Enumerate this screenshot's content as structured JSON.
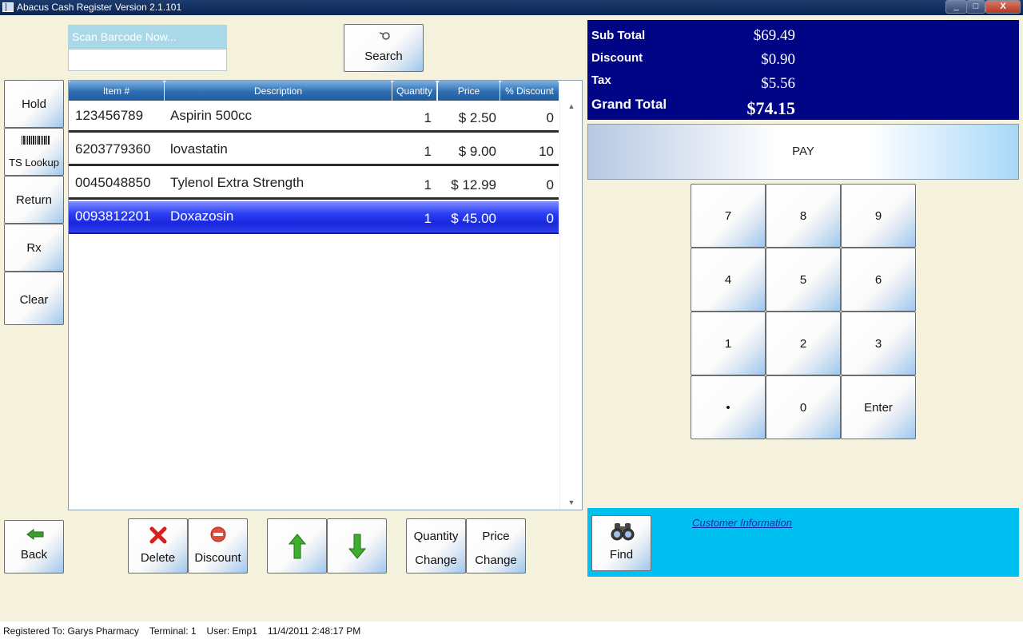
{
  "window": {
    "title": "Abacus Cash Register Version 2.1.101",
    "min_glyph": "_",
    "max_glyph": "□",
    "close_glyph": "X"
  },
  "scan": {
    "label": "Scan Barcode Now...",
    "value": ""
  },
  "search_button": {
    "label": "Search",
    "icon": "search-icon"
  },
  "side_buttons": {
    "hold": "Hold",
    "ts_lookup": "TS Lookup",
    "return": "Return",
    "rx": "Rx",
    "clear": "Clear"
  },
  "grid": {
    "columns": [
      "Item #",
      "Description",
      "Quantity",
      "Price",
      "% Discount"
    ],
    "rows": [
      {
        "item": "123456789",
        "description": "Aspirin 500cc",
        "quantity": "1",
        "price": "$ 2.50",
        "discount": "0",
        "selected": false
      },
      {
        "item": "6203779360",
        "description": "lovastatin",
        "quantity": "1",
        "price": "$ 9.00",
        "discount": "10",
        "selected": false
      },
      {
        "item": "0045048850",
        "description": "Tylenol Extra Strength",
        "quantity": "1",
        "price": "$ 12.99",
        "discount": "0",
        "selected": false
      },
      {
        "item": "0093812201",
        "description": "Doxazosin",
        "quantity": "1",
        "price": "$ 45.00",
        "discount": "0",
        "selected": true
      }
    ]
  },
  "totals": {
    "subtotal_label": "Sub Total",
    "subtotal": "$69.49",
    "discount_label": "Discount",
    "discount": "$0.90",
    "tax_label": "Tax",
    "tax": "$5.56",
    "grand_label": "Grand Total",
    "grand": "$74.15"
  },
  "pay_button": "PAY",
  "keypad": [
    "7",
    "8",
    "9",
    "4",
    "5",
    "6",
    "1",
    "2",
    "3",
    "•",
    "0",
    "Enter"
  ],
  "bottom_buttons": {
    "back": "Back",
    "delete": "Delete",
    "discount": "Discount",
    "quantity_change_1": "Quantity",
    "quantity_change_2": "Change",
    "price_change_1": "Price",
    "price_change_2": "Change"
  },
  "customer": {
    "link": "Customer Information",
    "find": "Find"
  },
  "status": {
    "registered": "Registered To: Garys Pharmacy",
    "terminal": "Terminal: 1",
    "user": "User: Emp1",
    "datetime": "11/4/2011 2:48:17 PM"
  },
  "colors": {
    "totals_bg": "#000585",
    "customer_bg": "#00c0f2",
    "selected_row": "#1a27e0"
  }
}
